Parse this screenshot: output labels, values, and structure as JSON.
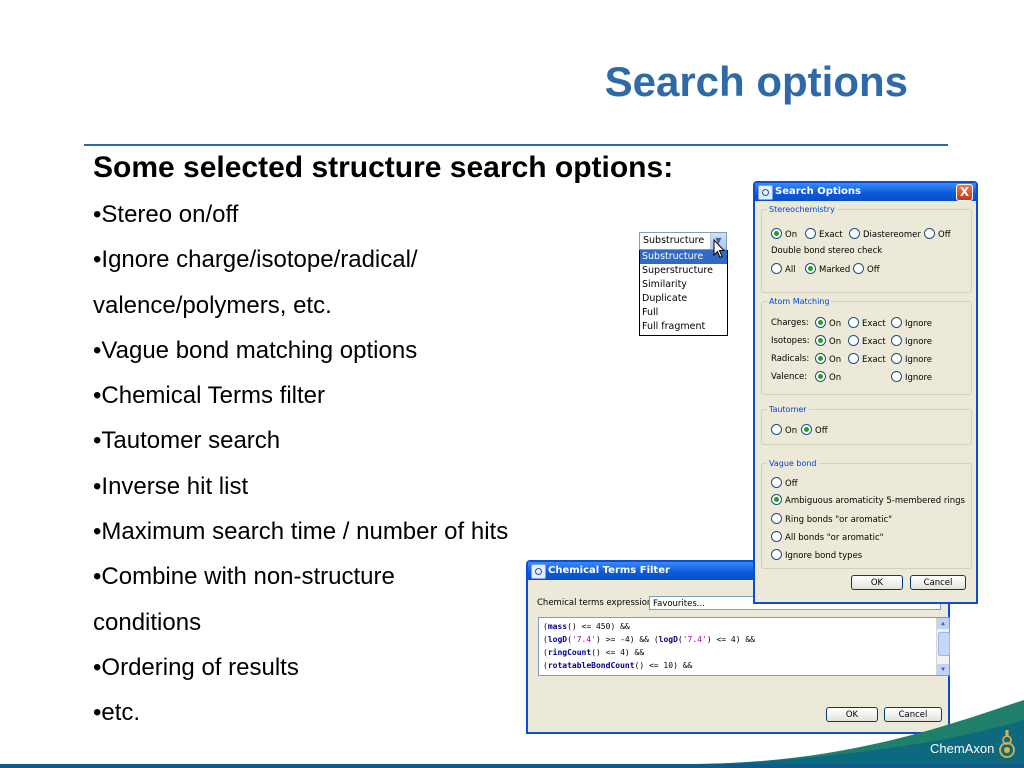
{
  "slide": {
    "title": "Search options",
    "heading": "Some selected structure search options:",
    "bullets": [
      "•Stereo on/off",
      "•Ignore charge/isotope/radical/",
      "valence/polymers, etc.",
      "•Vague bond matching options",
      "•Chemical Terms filter",
      "•Tautomer search",
      "•Inverse hit list",
      "•Maximum search time / number of hits",
      "•Combine with non-structure",
      "conditions",
      "•Ordering of results",
      "•etc."
    ]
  },
  "dropdown": {
    "value": "Substructure",
    "options": [
      "Substructure",
      "Superstructure",
      "Similarity",
      "Duplicate",
      "Full",
      "Full fragment"
    ],
    "selected_index": 0
  },
  "search_options": {
    "title": "Search Options",
    "close": "X",
    "stereo": {
      "legend": "Stereochemistry",
      "row1": [
        "On",
        "Exact",
        "Diastereomer",
        "Off"
      ],
      "row1_selected": 0,
      "double_bond_label": "Double bond stereo check",
      "row2": [
        "All",
        "Marked",
        "Off"
      ],
      "row2_selected": 1
    },
    "atom": {
      "legend": "Atom Matching",
      "charges": {
        "label": "Charges:",
        "options": [
          "On",
          "Exact",
          "Ignore"
        ],
        "selected": 0
      },
      "isotopes": {
        "label": "Isotopes:",
        "options": [
          "On",
          "Exact",
          "Ignore"
        ],
        "selected": 0
      },
      "radicals": {
        "label": "Radicals:",
        "options": [
          "On",
          "Exact",
          "Ignore"
        ],
        "selected": 0
      },
      "valence": {
        "label": "Valence:",
        "options": [
          "On",
          "Ignore"
        ],
        "selected": 0
      }
    },
    "tautomer": {
      "legend": "Tautomer",
      "options": [
        "On",
        "Off"
      ],
      "selected": 1
    },
    "vague": {
      "legend": "Vague bond",
      "options": [
        "Off",
        "Ambiguous aromaticity 5-membered rings",
        "Ring bonds \"or aromatic\"",
        "All bonds \"or aromatic\"",
        "Ignore bond types"
      ],
      "selected": 1
    },
    "ok": "OK",
    "cancel": "Cancel"
  },
  "chem_filter": {
    "title": "Chemical Terms Filter",
    "expr_label": "Chemical terms expression",
    "combo_value": "Favourites...",
    "code": [
      [
        {
          "t": "(",
          "c": ""
        },
        {
          "t": "mass",
          "c": "kw"
        },
        {
          "t": "() <= 450) &&",
          "c": ""
        }
      ],
      [
        {
          "t": "(",
          "c": ""
        },
        {
          "t": "logD",
          "c": "kw"
        },
        {
          "t": "(",
          "c": ""
        },
        {
          "t": "'7.4'",
          "c": "str"
        },
        {
          "t": ") >= -4) && (",
          "c": ""
        },
        {
          "t": "logD",
          "c": "kw"
        },
        {
          "t": "(",
          "c": ""
        },
        {
          "t": "'7.4'",
          "c": "str"
        },
        {
          "t": ") <= 4) &&",
          "c": ""
        }
      ],
      [
        {
          "t": "(",
          "c": ""
        },
        {
          "t": "ringCount",
          "c": "kw"
        },
        {
          "t": "() <= 4) &&",
          "c": ""
        }
      ],
      [
        {
          "t": "(",
          "c": ""
        },
        {
          "t": "rotatableBondCount",
          "c": "kw"
        },
        {
          "t": "() <= 10) &&",
          "c": ""
        }
      ]
    ],
    "ok": "OK",
    "cancel": "Cancel"
  },
  "footer": {
    "brand": "ChemAxon"
  }
}
